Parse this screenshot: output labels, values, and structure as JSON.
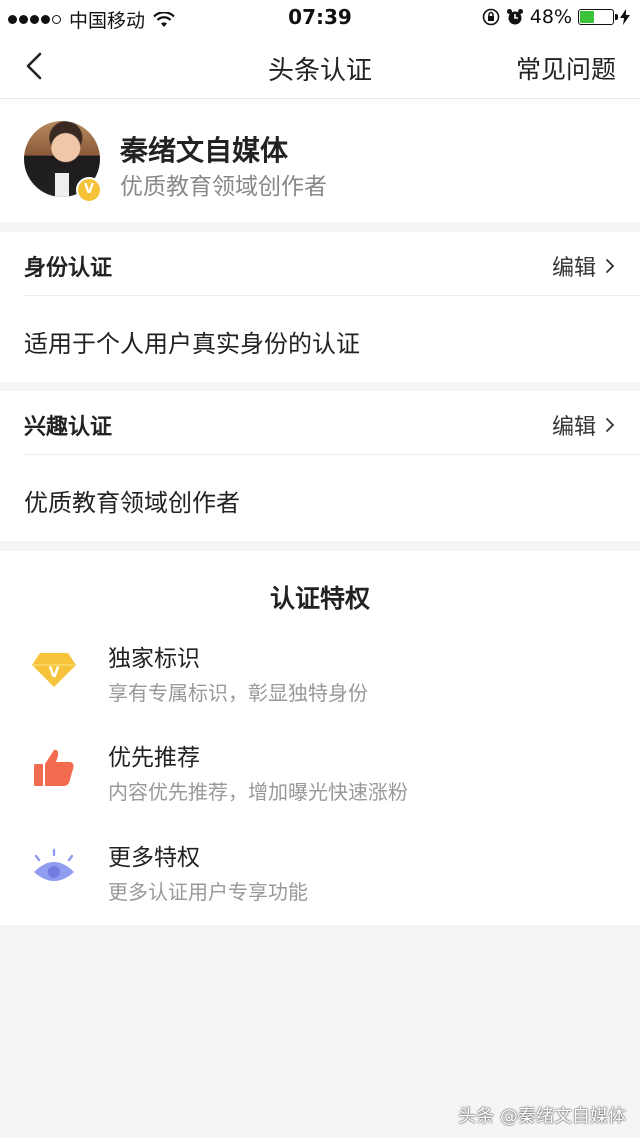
{
  "status_bar": {
    "carrier": "中国移动",
    "time": "07:39",
    "battery": "48%",
    "battery_level": 0.48
  },
  "nav": {
    "title": "头条认证",
    "faq_label": "常见问题"
  },
  "profile": {
    "name": "秦绪文自媒体",
    "subtitle": "优质教育领域创作者",
    "badge": "V"
  },
  "identity": {
    "heading": "身份认证",
    "edit_label": "编辑",
    "body": "适用于个人用户真实身份的认证"
  },
  "interest": {
    "heading": "兴趣认证",
    "edit_label": "编辑",
    "body": "优质教育领域创作者"
  },
  "privileges": {
    "title": "认证特权",
    "items": [
      {
        "name": "独家标识",
        "desc": "享有专属标识，彰显独特身份",
        "icon": "diamond-icon"
      },
      {
        "name": "优先推荐",
        "desc": "内容优先推荐，增加曝光快速涨粉",
        "icon": "thumbs-up-icon"
      },
      {
        "name": "更多特权",
        "desc": "更多认证用户专享功能",
        "icon": "eye-icon"
      }
    ]
  },
  "watermark": "头条 @秦绪文自媒体",
  "colors": {
    "diamond": "#f6c33a",
    "thumb": "#f26b4f",
    "eye": "#8f9cf0"
  }
}
